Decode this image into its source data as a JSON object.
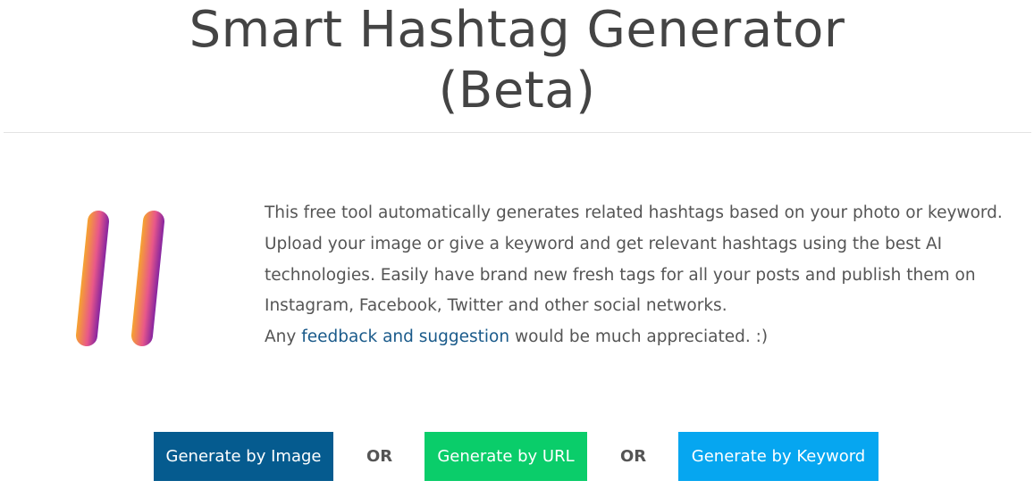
{
  "header": {
    "title_line1": "Smart Hashtag Generator",
    "title_line2": "(Beta)"
  },
  "logo": {
    "icon": "hashtag-icon",
    "gradient_colors": [
      "#f7a928",
      "#e8578a",
      "#7b1fa2"
    ]
  },
  "intro": {
    "text": "This free tool automatically generates related hashtags based on your photo or keyword. Upload your image or give a keyword and get relevant hashtags using the best AI technologies. Easily have brand new fresh tags for all your posts and publish them on Instagram, Facebook, Twitter and other social networks.",
    "feedback_prefix": "Any ",
    "feedback_link": "feedback and suggestion",
    "feedback_suffix": " would be much appreciated. :)"
  },
  "actions": {
    "by_image_label": "Generate by Image",
    "or_label_1": "OR",
    "by_url_label": "Generate by URL",
    "or_label_2": "OR",
    "by_keyword_label": "Generate by Keyword"
  },
  "colors": {
    "by_image": "#055b8f",
    "by_url": "#0acd6a",
    "by_keyword": "#06a6f0",
    "link": "#1a5a8a"
  }
}
